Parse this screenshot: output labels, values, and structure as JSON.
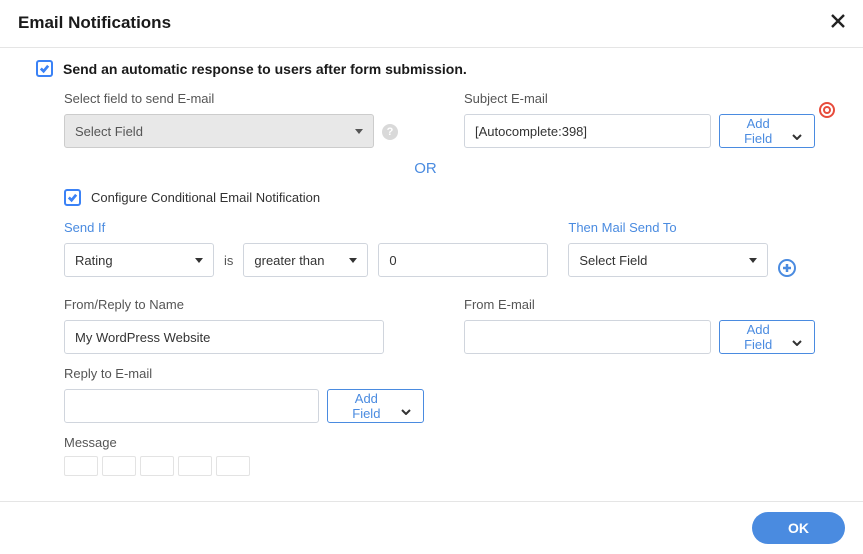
{
  "header": {
    "title": "Email Notifications"
  },
  "auto_response": {
    "checked": true,
    "label": "Send an automatic response to users after form submission.",
    "select_field_label": "Select field to send E-mail",
    "select_field_value": "Select Field",
    "subject_label": "Subject E-mail",
    "subject_value": "[Autocomplete:398]",
    "add_field_label": "Add Field"
  },
  "or_text": "OR",
  "conditional": {
    "checked": true,
    "label": "Configure Conditional Email Notification",
    "send_if_label": "Send If",
    "field": "Rating",
    "operator_prefix": "is",
    "operator": "greater than",
    "value": "0",
    "then_label": "Then Mail Send To",
    "then_value": "Select Field"
  },
  "from": {
    "name_label": "From/Reply to Name",
    "name_value": "My WordPress Website",
    "email_label": "From E-mail",
    "email_value": "",
    "add_field_label": "Add Field"
  },
  "reply": {
    "label": "Reply to E-mail",
    "value": "",
    "add_field_label": "Add Field"
  },
  "message": {
    "label": "Message"
  },
  "footer": {
    "ok": "OK"
  }
}
